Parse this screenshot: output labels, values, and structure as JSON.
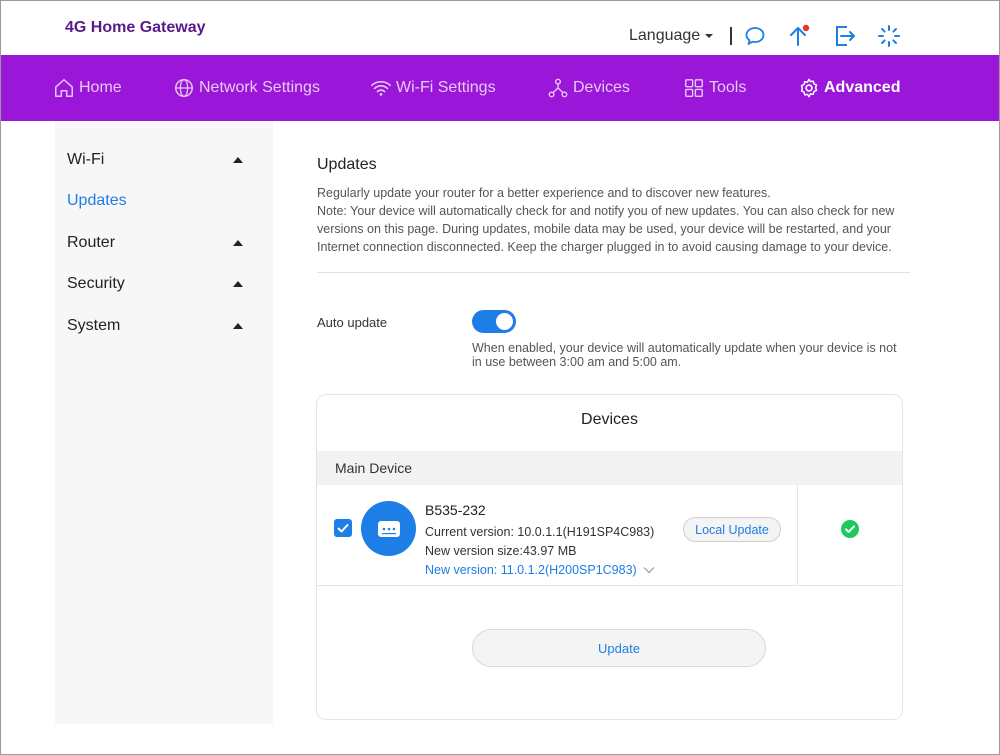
{
  "header": {
    "brand": "4G Home Gateway",
    "language_label": "Language",
    "icons": [
      "message-icon",
      "update-arrow-icon",
      "logout-icon",
      "loading-icon"
    ],
    "badge_color": "#e8352c"
  },
  "nav": {
    "items": [
      {
        "label": "Home",
        "icon": "home-icon"
      },
      {
        "label": "Network Settings",
        "icon": "globe-icon"
      },
      {
        "label": "Wi-Fi Settings",
        "icon": "wifi-icon"
      },
      {
        "label": "Devices",
        "icon": "devices-icon"
      },
      {
        "label": "Tools",
        "icon": "tools-icon"
      },
      {
        "label": "Advanced",
        "icon": "gear-icon"
      }
    ],
    "active": "Advanced",
    "background": "#9a16d8"
  },
  "sidebar": {
    "items": [
      {
        "label": "Wi-Fi",
        "expandable": true
      },
      {
        "label": "Updates",
        "expandable": false
      },
      {
        "label": "Router",
        "expandable": true
      },
      {
        "label": "Security",
        "expandable": true
      },
      {
        "label": "System",
        "expandable": true
      }
    ],
    "active": "Updates"
  },
  "main": {
    "title": "Updates",
    "desc_line1": "Regularly update your router for a better experience and to discover new features.",
    "desc_line2": "Note: Your device will automatically check for and notify you of new updates. You can also check for new versions on this page. During updates, mobile data may be used, your device will be restarted, and your Internet connection disconnected. Keep the charger plugged in to avoid causing damage to your device.",
    "auto_update": {
      "label": "Auto update",
      "enabled": true,
      "description": "When enabled, your device will automatically update when your device is not in use between 3:00 am and 5:00 am."
    },
    "devices_card": {
      "title": "Devices",
      "section": "Main Device",
      "device": {
        "name": "B535-232",
        "current_version": "Current version: 10.0.1.1(H191SP4C983)",
        "new_size": "New version size:43.97 MB",
        "new_version": "New version: 11.0.1.2(H200SP1C983)",
        "checked": true,
        "local_update_label": "Local Update",
        "status": "ok"
      },
      "update_button": "Update"
    }
  },
  "colors": {
    "accent": "#1d7ee5",
    "brand_text": "#5a1a8c",
    "success": "#1ec85c"
  }
}
